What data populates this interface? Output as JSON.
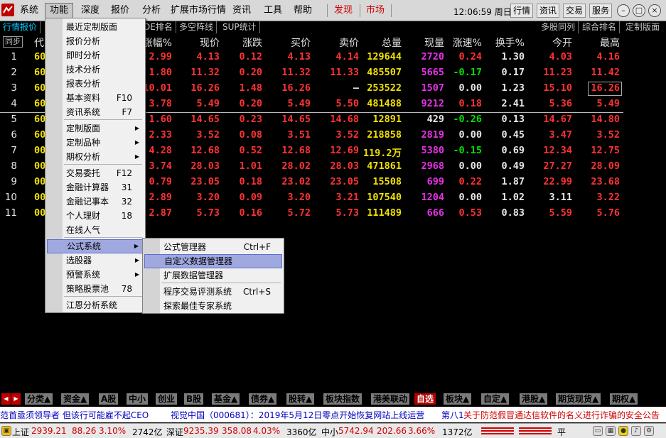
{
  "menubar": {
    "items": [
      "系统",
      "功能",
      "深度",
      "报价",
      "分析",
      "扩展市场行情",
      "资讯",
      "工具",
      "帮助",
      "发现",
      "市场"
    ],
    "clock": "12:06:59 周日",
    "buttons": [
      "行情",
      "资讯",
      "交易",
      "服务"
    ]
  },
  "tabs": [
    "行情报价",
    "DE排名",
    "多空阵线",
    "SUP统计",
    "多股同列",
    "综合排名",
    "定制版面"
  ],
  "table": {
    "sync_label": "同步",
    "headers": [
      "代",
      "涨幅%",
      "现价",
      "涨跌",
      "买价",
      "卖价",
      "总量",
      "现量",
      "涨速%",
      "换手%",
      "今开",
      "最高"
    ],
    "rows": [
      {
        "n": "1",
        "code": "60",
        "chg_pct": "2.99",
        "price": "4.13",
        "chg": "0.12",
        "bid": "4.13",
        "ask": "4.14",
        "vol": "129644",
        "cur": "2720",
        "speed": "0.24",
        "turn": "1.30",
        "open": "4.03",
        "high": "4.16"
      },
      {
        "n": "2",
        "code": "60",
        "chg_pct": "1.80",
        "price": "11.32",
        "chg": "0.20",
        "bid": "11.32",
        "ask": "11.33",
        "vol": "485507",
        "cur": "5665",
        "speed": "-0.17",
        "turn": "0.17",
        "open": "11.23",
        "high": "11.42"
      },
      {
        "n": "3",
        "code": "60",
        "chg_pct": "10.01",
        "price": "16.26",
        "chg": "1.48",
        "bid": "16.26",
        "ask": "—",
        "vol": "253522",
        "cur": "1507",
        "speed": "0.00",
        "turn": "1.23",
        "open": "15.10",
        "high": "16.26"
      },
      {
        "n": "4",
        "code": "60",
        "chg_pct": "3.78",
        "price": "5.49",
        "chg": "0.20",
        "bid": "5.49",
        "ask": "5.50",
        "vol": "481488",
        "cur": "9212",
        "speed": "0.18",
        "turn": "2.41",
        "open": "5.36",
        "high": "5.49"
      },
      {
        "n": "5",
        "code": "60",
        "chg_pct": "1.60",
        "price": "14.65",
        "chg": "0.23",
        "bid": "14.65",
        "ask": "14.68",
        "vol": "12891",
        "cur": "429",
        "speed": "-0.26",
        "turn": "0.13",
        "open": "14.67",
        "high": "14.80"
      },
      {
        "n": "6",
        "code": "60",
        "chg_pct": "2.33",
        "price": "3.52",
        "chg": "0.08",
        "bid": "3.51",
        "ask": "3.52",
        "vol": "218858",
        "cur": "2819",
        "speed": "0.00",
        "turn": "0.45",
        "open": "3.47",
        "high": "3.52"
      },
      {
        "n": "7",
        "code": "00",
        "chg_pct": "4.28",
        "price": "12.68",
        "chg": "0.52",
        "bid": "12.68",
        "ask": "12.69",
        "vol": "119.2万",
        "cur": "5380",
        "speed": "-0.15",
        "turn": "0.69",
        "open": "12.34",
        "high": "12.75"
      },
      {
        "n": "8",
        "code": "00",
        "chg_pct": "3.74",
        "price": "28.03",
        "chg": "1.01",
        "bid": "28.02",
        "ask": "28.03",
        "vol": "471861",
        "cur": "2968",
        "speed": "0.00",
        "turn": "0.49",
        "open": "27.27",
        "high": "28.09"
      },
      {
        "n": "9",
        "code": "00",
        "chg_pct": "0.79",
        "price": "23.05",
        "chg": "0.18",
        "bid": "23.02",
        "ask": "23.05",
        "vol": "15508",
        "cur": "699",
        "speed": "0.22",
        "turn": "1.87",
        "open": "22.99",
        "high": "23.68"
      },
      {
        "n": "10",
        "code": "00",
        "chg_pct": "2.89",
        "price": "3.20",
        "chg": "0.09",
        "bid": "3.20",
        "ask": "3.21",
        "vol": "107540",
        "cur": "1204",
        "speed": "0.00",
        "turn": "1.02",
        "open": "3.11",
        "high": "3.22"
      },
      {
        "n": "11",
        "code": "00",
        "chg_pct": "2.87",
        "price": "5.73",
        "chg": "0.16",
        "bid": "5.72",
        "ask": "5.73",
        "vol": "111489",
        "cur": "666",
        "speed": "0.53",
        "turn": "0.83",
        "open": "5.59",
        "high": "5.76"
      }
    ]
  },
  "menu_function": [
    {
      "label": "最近定制版面",
      "shortcut": "",
      "submenu": false
    },
    {
      "label": "报价分析",
      "shortcut": "",
      "submenu": false
    },
    {
      "label": "即时分析",
      "shortcut": "",
      "submenu": false
    },
    {
      "label": "技术分析",
      "shortcut": "",
      "submenu": false
    },
    {
      "label": "报表分析",
      "shortcut": "",
      "submenu": false
    },
    {
      "label": "基本资料",
      "shortcut": "F10",
      "submenu": false
    },
    {
      "label": "资讯系统",
      "shortcut": "F7",
      "submenu": false
    },
    {
      "label": "定制版面",
      "shortcut": "",
      "submenu": true
    },
    {
      "label": "定制品种",
      "shortcut": "",
      "submenu": true
    },
    {
      "label": "期权分析",
      "shortcut": "",
      "submenu": true
    },
    {
      "label": "交易委托",
      "shortcut": "F12",
      "submenu": false
    },
    {
      "label": "金融计算器",
      "shortcut": "31",
      "submenu": false
    },
    {
      "label": "金融记事本",
      "shortcut": "32",
      "submenu": false
    },
    {
      "label": "个人理财",
      "shortcut": "18",
      "submenu": false
    },
    {
      "label": "在线人气",
      "shortcut": "",
      "submenu": false
    },
    {
      "label": "公式系统",
      "shortcut": "",
      "submenu": true
    },
    {
      "label": "选股器",
      "shortcut": "",
      "submenu": true
    },
    {
      "label": "预警系统",
      "shortcut": "",
      "submenu": true
    },
    {
      "label": "策略股票池",
      "shortcut": "78",
      "submenu": false
    },
    {
      "label": "江恩分析系统",
      "shortcut": "",
      "submenu": false
    }
  ],
  "menu_formula": [
    {
      "label": "公式管理器",
      "shortcut": "Ctrl+F"
    },
    {
      "label": "自定义数据管理器",
      "shortcut": ""
    },
    {
      "label": "扩展数据管理器",
      "shortcut": ""
    },
    {
      "label": "程序交易评测系统",
      "shortcut": "Ctrl+S"
    },
    {
      "label": "探索最佳专家系统",
      "shortcut": ""
    }
  ],
  "bottom_tabs": [
    "分类▲",
    "资金▲",
    "A股",
    "中小",
    "创业",
    "B股",
    "基金▲",
    "债券▲",
    "股转▲",
    "板块指数",
    "港美联动",
    "自选",
    "板块▲",
    "自定▲",
    "港股▲",
    "期货现货▲",
    "期权▲"
  ],
  "ticker": {
    "left": "范首亟须领导者 但该行可能雇不起CEO",
    "middle": "视觉中国（000681）：2019年5月12日零点开始恢复网站上线运营",
    "right_prefix": "第八1",
    "right": "关于防范假冒通达信软件的名义进行诈骗的安全公告"
  },
  "status": {
    "sh_label": "上证",
    "sh_value": "2939.21",
    "sh_chg": "88.26",
    "sh_pct": "3.10%",
    "sh_amt": "2742亿",
    "sz_label": "深证",
    "sz_value": "9235.39",
    "sz_chg": "358.08",
    "sz_pct": "4.03%",
    "sz_amt": "3360亿",
    "zx_label": "中小",
    "zx_value": "5742.94",
    "zx_chg": "202.66",
    "zx_pct": "3.66%",
    "zx_amt": "1372亿",
    "flat": "平"
  },
  "colors": {
    "up": "#ff3232",
    "down": "#00e000",
    "accent": "#00c8ff",
    "selected_tab": "#b00000"
  }
}
